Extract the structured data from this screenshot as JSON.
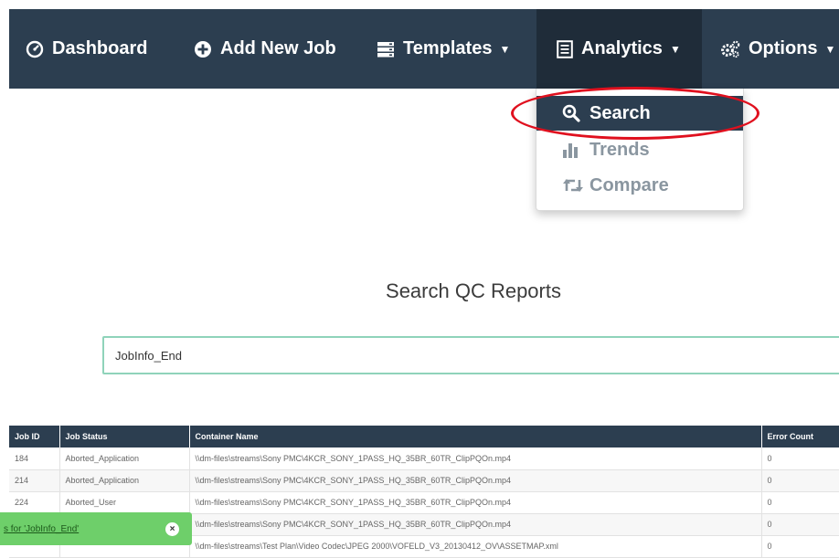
{
  "nav": {
    "dashboard": "Dashboard",
    "add_new_job": "Add New Job",
    "templates": "Templates",
    "analytics": "Analytics",
    "options": "Options"
  },
  "analytics_menu": {
    "search": "Search",
    "trends": "Trends",
    "compare": "Compare"
  },
  "page_title": "Search QC Reports",
  "search": {
    "value": "JobInfo_End"
  },
  "table": {
    "headers": [
      "Job ID",
      "Job Status",
      "Container Name",
      "Error Count"
    ],
    "rows": [
      [
        "184",
        "Aborted_Application",
        "\\\\dm-files\\streams\\Sony PMC\\4KCR_SONY_1PASS_HQ_35BR_60TR_ClipPQOn.mp4",
        "0"
      ],
      [
        "214",
        "Aborted_Application",
        "\\\\dm-files\\streams\\Sony PMC\\4KCR_SONY_1PASS_HQ_35BR_60TR_ClipPQOn.mp4",
        "0"
      ],
      [
        "224",
        "Aborted_User",
        "\\\\dm-files\\streams\\Sony PMC\\4KCR_SONY_1PASS_HQ_35BR_60TR_ClipPQOn.mp4",
        "0"
      ],
      [
        "",
        "",
        "\\\\dm-files\\streams\\Sony PMC\\4KCR_SONY_1PASS_HQ_35BR_60TR_ClipPQOn.mp4",
        "0"
      ],
      [
        "",
        "",
        "\\\\dm-files\\streams\\Test Plan\\Video Codec\\JPEG 2000\\VOFELD_V3_20130412_OV\\ASSETMAP.xml",
        "0"
      ]
    ]
  },
  "toast": {
    "message": "s for 'JobInfo_End'",
    "close": "×"
  },
  "colors": {
    "navbar": "#2c3e50",
    "highlight": "#e0101e",
    "toast": "#6ecf6a",
    "search_border": "#8fd3ba"
  }
}
